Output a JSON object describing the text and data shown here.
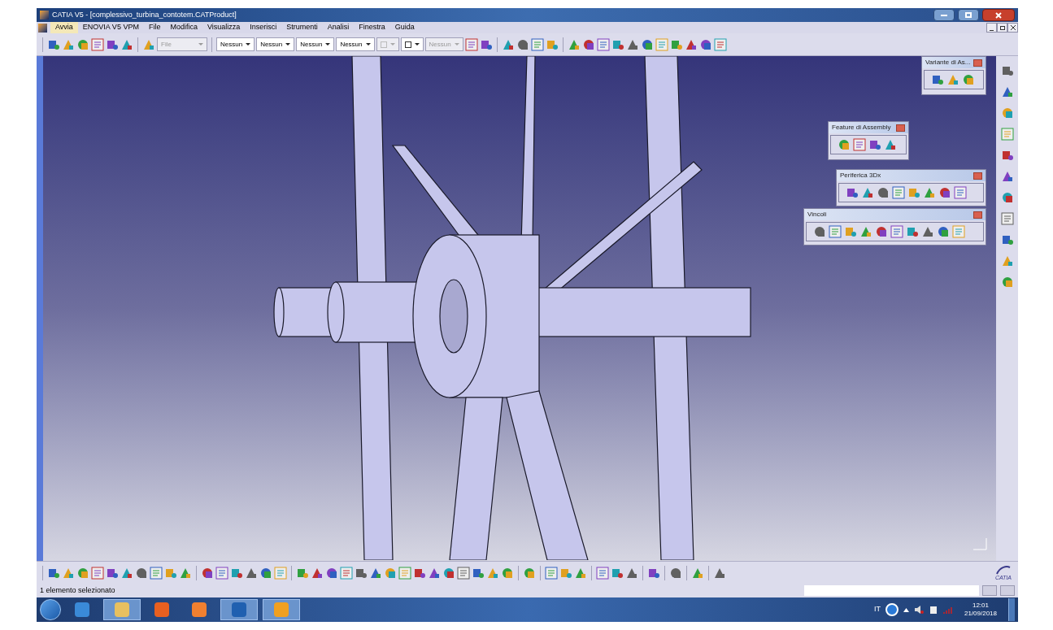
{
  "window": {
    "title": "CATIA V5 - [complessivo_turbina_contotem.CATProduct]"
  },
  "menu": [
    {
      "label": "Avvia",
      "selected": true
    },
    {
      "label": "ENOVIA V5 VPM",
      "selected": false
    },
    {
      "label": "File",
      "selected": false
    },
    {
      "label": "Modifica",
      "selected": false
    },
    {
      "label": "Visualizza",
      "selected": false
    },
    {
      "label": "Inserisci",
      "selected": false
    },
    {
      "label": "Strumenti",
      "selected": false
    },
    {
      "label": "Analisi",
      "selected": false
    },
    {
      "label": "Finestra",
      "selected": false
    },
    {
      "label": "Guida",
      "selected": false
    }
  ],
  "toolbar": {
    "file_combo": {
      "text": "File",
      "disabled": true
    },
    "combos": [
      {
        "kind": "text",
        "text": "Nessun",
        "disabled": false
      },
      {
        "kind": "text",
        "text": "Nessun",
        "disabled": false
      },
      {
        "kind": "text",
        "text": "Nessun",
        "disabled": false
      },
      {
        "kind": "text",
        "text": "Nessun",
        "disabled": false
      },
      {
        "kind": "icon",
        "disabled": true
      },
      {
        "kind": "icon",
        "disabled": false
      },
      {
        "kind": "text",
        "text": "Nessun",
        "disabled": true
      }
    ]
  },
  "floating_toolbars": [
    {
      "title": "Variante di As..."
    },
    {
      "title": "Feature di Assembly"
    },
    {
      "title": "Periferica 3Dx"
    },
    {
      "title": "Vincoli"
    }
  ],
  "logo": {
    "text": "CATIA"
  },
  "status_bar": {
    "message": "1 elemento selezionato"
  },
  "taskbar": {
    "language": "IT",
    "time": "12:01",
    "date": "21/09/2018"
  }
}
